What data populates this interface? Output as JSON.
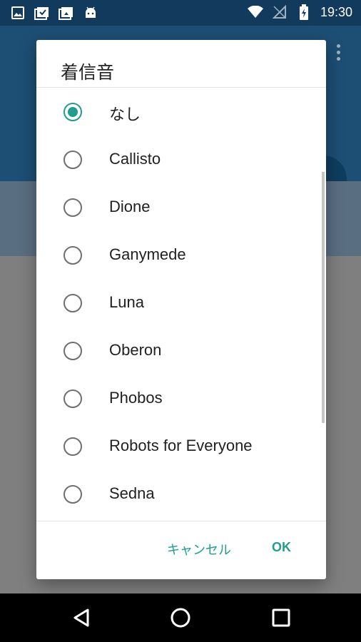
{
  "status_bar": {
    "time": "19:30",
    "left_icons": [
      "image-icon",
      "download-check-icon",
      "download-image-icon",
      "android-icon"
    ],
    "right_icons": [
      "wifi-icon",
      "no-signal-icon",
      "battery-charging-icon"
    ]
  },
  "dialog": {
    "title": "着信音",
    "options": [
      {
        "label": "なし",
        "selected": true
      },
      {
        "label": "Callisto",
        "selected": false
      },
      {
        "label": "Dione",
        "selected": false
      },
      {
        "label": "Ganymede",
        "selected": false
      },
      {
        "label": "Luna",
        "selected": false
      },
      {
        "label": "Oberon",
        "selected": false
      },
      {
        "label": "Phobos",
        "selected": false
      },
      {
        "label": "Robots for Everyone",
        "selected": false
      },
      {
        "label": "Sedna",
        "selected": false
      }
    ],
    "cancel_label": "キャンセル",
    "ok_label": "OK"
  },
  "colors": {
    "accent": "#1f9e8d",
    "status_bar": "#113a5c",
    "app_bar": "#1d4e74"
  },
  "nav_bar": {
    "icons": [
      "back-icon",
      "home-icon",
      "recents-icon"
    ]
  }
}
